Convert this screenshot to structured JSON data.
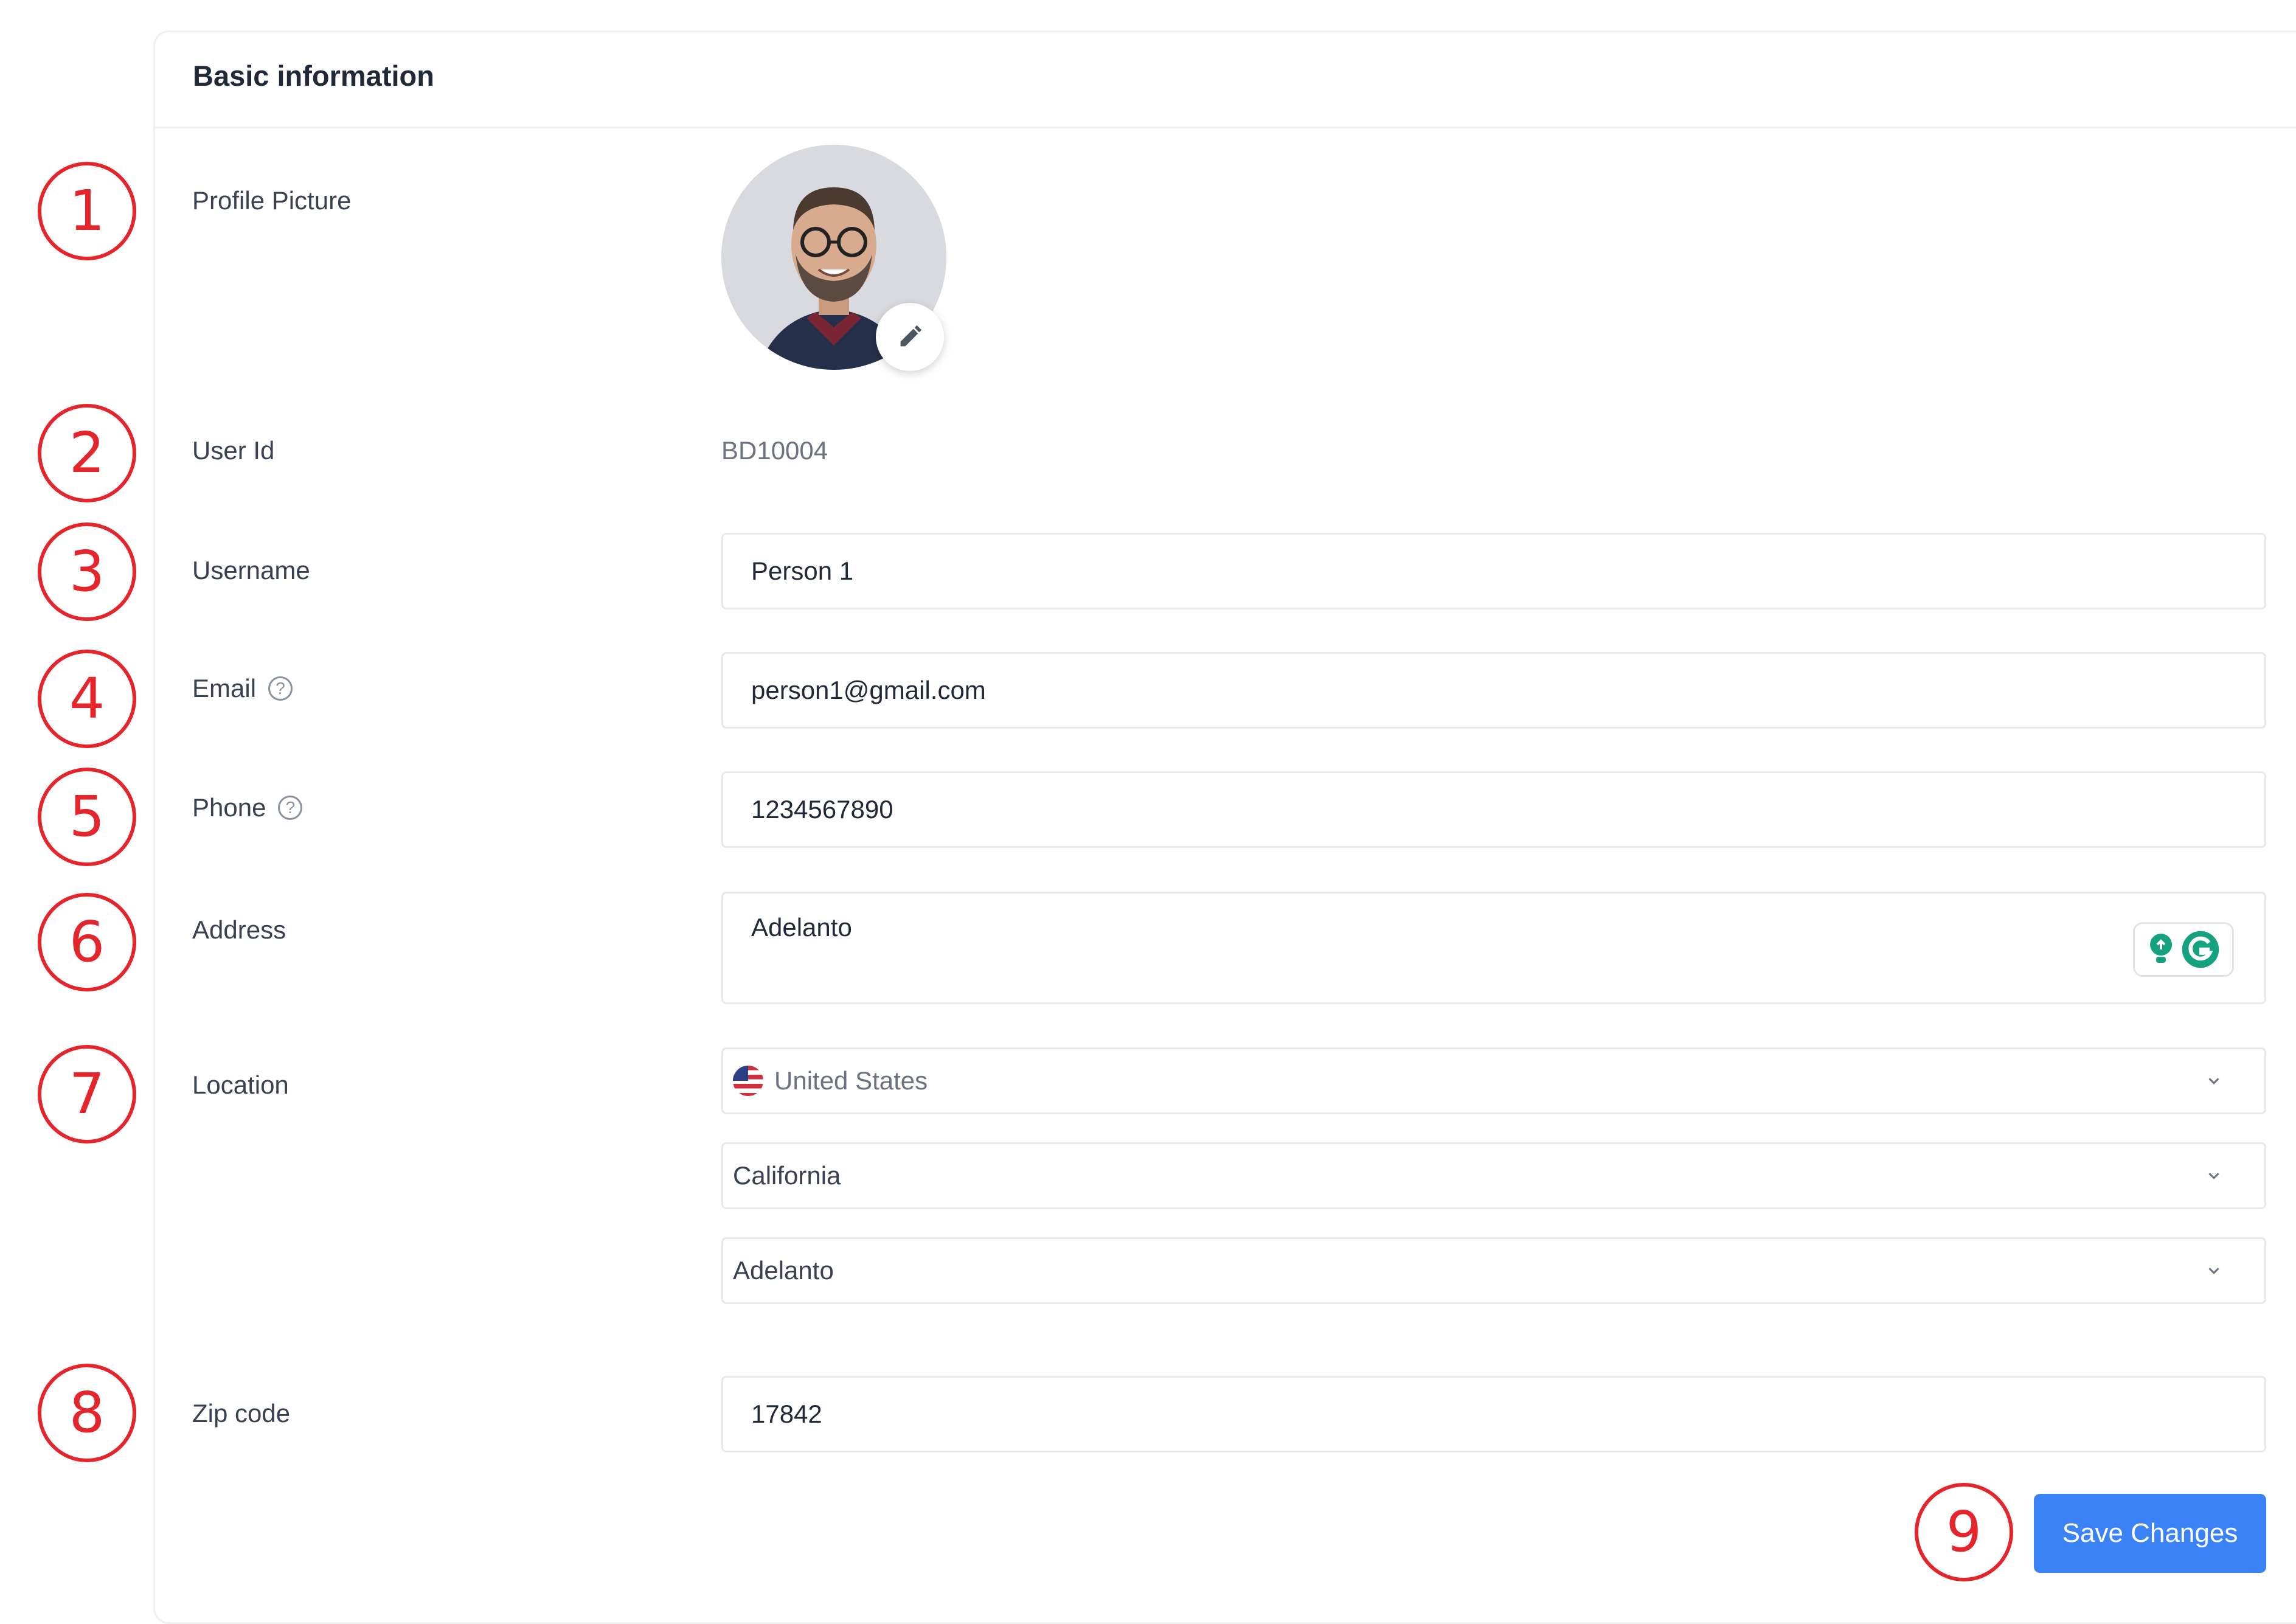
{
  "card": {
    "title": "Basic information"
  },
  "badges": [
    "1",
    "2",
    "3",
    "4",
    "5",
    "6",
    "7",
    "8",
    "9"
  ],
  "profile": {
    "label": "Profile Picture",
    "edit_icon": "pencil-icon"
  },
  "user_id": {
    "label": "User Id",
    "value": "BD10004"
  },
  "username": {
    "label": "Username",
    "value": "Person 1"
  },
  "email": {
    "label": "Email",
    "value": "person1@gmail.com",
    "help_icon": "question-circle-icon"
  },
  "phone": {
    "label": "Phone",
    "value": "1234567890",
    "help_icon": "question-circle-icon"
  },
  "address": {
    "label": "Address",
    "value": "Adelanto"
  },
  "location": {
    "label": "Location",
    "country": {
      "value": "United States",
      "flag_icon": "us-flag-icon"
    },
    "state": {
      "value": "California"
    },
    "city": {
      "value": "Adelanto"
    }
  },
  "zip": {
    "label": "Zip code",
    "value": "17842"
  },
  "save_button": {
    "label": "Save Changes"
  },
  "colors": {
    "accent": "#3b82f6",
    "annotation": "#e5252c",
    "border": "#e7e9ec"
  }
}
